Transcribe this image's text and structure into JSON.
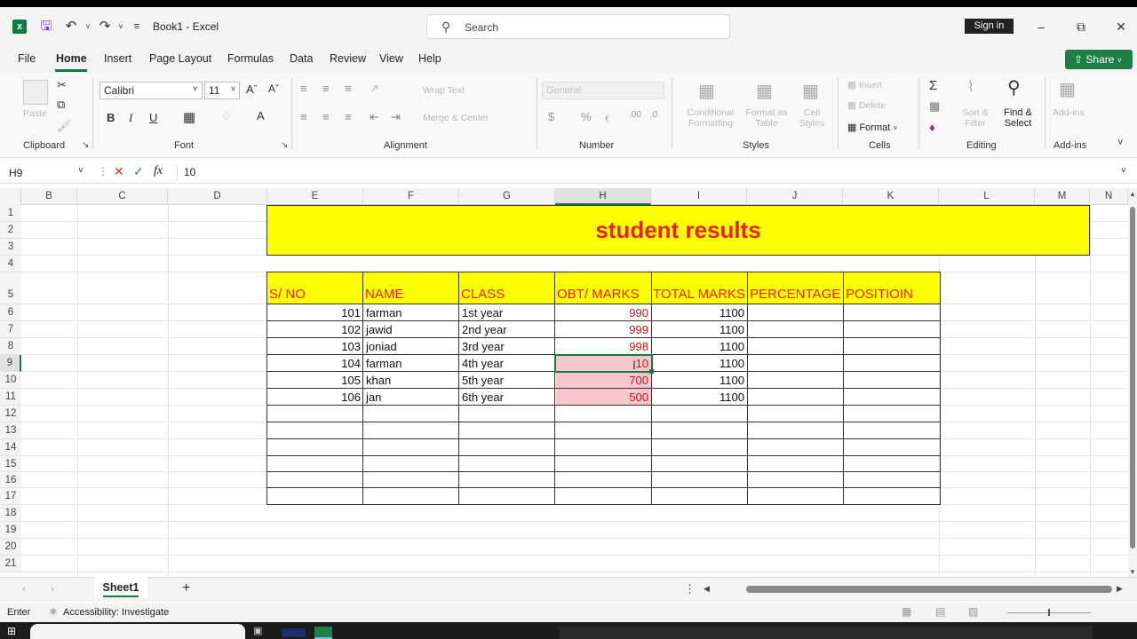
{
  "titlebar": {
    "file_title": "Book1  -  Excel",
    "search_placeholder": "Search",
    "signin_label": "Sign in"
  },
  "menu": {
    "tabs": [
      "File",
      "Home",
      "Insert",
      "Page Layout",
      "Formulas",
      "Data",
      "Review",
      "View",
      "Help"
    ],
    "active": "Home",
    "share_label": "Share"
  },
  "ribbon": {
    "groups": [
      "Clipboard",
      "Font",
      "Alignment",
      "Number",
      "Styles",
      "Cells",
      "Editing",
      "Add-ins"
    ],
    "paste_label": "Paste",
    "font_name": "Calibri",
    "font_size": "11",
    "wrap_text": "Wrap Text",
    "merge_center": "Merge & Center",
    "number_format": "General",
    "cond_format_line1": "Conditional",
    "cond_format_line2": "Formatting",
    "format_table_line1": "Format as",
    "format_table_line2": "Table",
    "cell_styles_line1": "Cell",
    "cell_styles_line2": "Styles",
    "insert_label": "Insert",
    "delete_label": "Delete",
    "format_label": "Format",
    "sort_filter_line1": "Sort &",
    "sort_filter_line2": "Filter",
    "find_select_line1": "Find &",
    "find_select_line2": "Select",
    "addins_label": "Add-ins"
  },
  "formula_bar": {
    "name_box": "H9",
    "formula": "10"
  },
  "grid": {
    "columns": [
      "B",
      "C",
      "D",
      "E",
      "F",
      "G",
      "H",
      "I",
      "J",
      "K",
      "L",
      "M",
      "N"
    ],
    "rows": [
      "1",
      "2",
      "3",
      "4",
      "5",
      "6",
      "7",
      "8",
      "9",
      "10",
      "11",
      "12",
      "13",
      "14",
      "15",
      "16",
      "17",
      "18",
      "19",
      "20",
      "21"
    ],
    "selected_cell": "H9"
  },
  "sheet": {
    "title": "student results",
    "headers": [
      "S/ NO",
      "NAME",
      "CLASS",
      "OBT/ MARKS",
      "TOTAL MARKS",
      "PERCENTAGE",
      "POSITIOIN"
    ],
    "rows": [
      {
        "sno": "101",
        "name": "farman",
        "class": "1st year",
        "obt": "990",
        "total": "1100"
      },
      {
        "sno": "102",
        "name": "jawid",
        "class": "2nd year",
        "obt": "999",
        "total": "1100"
      },
      {
        "sno": "103",
        "name": "joniad",
        "class": "3rd year",
        "obt": "998",
        "total": "1100"
      },
      {
        "sno": "104",
        "name": "farman",
        "class": "4th year",
        "obt": "10",
        "total": "1100"
      },
      {
        "sno": "105",
        "name": "khan",
        "class": "5th year",
        "obt": "700",
        "total": "1100"
      },
      {
        "sno": "106",
        "name": "jan",
        "class": "6th year",
        "obt": "500",
        "total": "1100"
      }
    ],
    "colors": {
      "title_fill": "#ffff00",
      "title_text": "#e8231f",
      "highlight_fill": "#f8c7ce",
      "highlight_text": "#c0161f"
    }
  },
  "bottom": {
    "sheet_tab": "Sheet1",
    "status_mode": "Enter",
    "accessibility": "Accessibility: Investigate"
  }
}
